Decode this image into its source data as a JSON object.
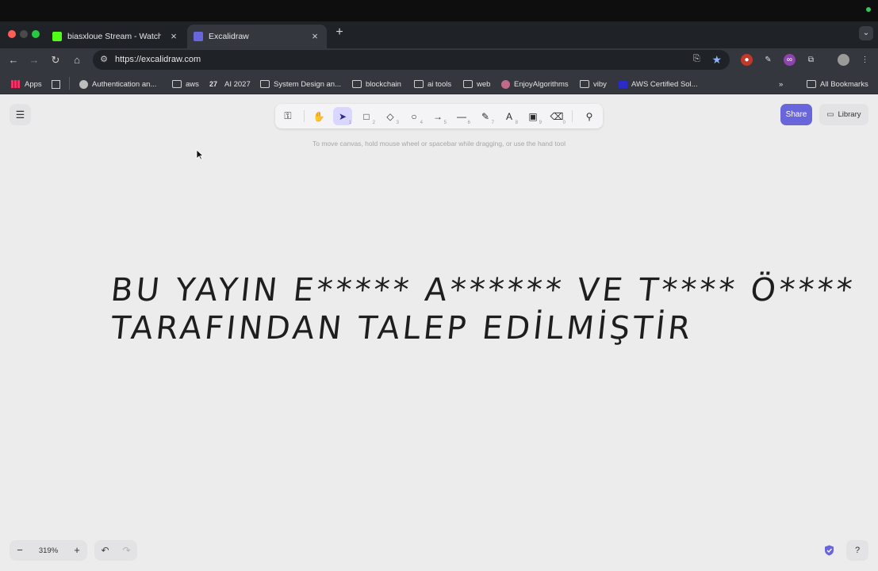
{
  "browser": {
    "tabs": [
      {
        "title": "biasxloue Stream - Watch Liv",
        "active": false,
        "favicon_color": "#53fc18"
      },
      {
        "title": "Excalidraw",
        "active": true,
        "favicon_color": "#6965db"
      }
    ],
    "close_glyph": "×",
    "new_tab_glyph": "+",
    "url": "https://excalidraw.com",
    "bookmarks": [
      {
        "label": "Apps",
        "icon": "apps-grid-icon"
      },
      {
        "label": "Authentication an...",
        "icon": "globe-icon"
      },
      {
        "label": "aws",
        "icon": "folder-icon"
      },
      {
        "label": "AI 2027",
        "icon": "ai2027-icon"
      },
      {
        "label": "System Design an...",
        "icon": "folder-icon"
      },
      {
        "label": "blockchain",
        "icon": "folder-icon"
      },
      {
        "label": "ai tools",
        "icon": "folder-icon"
      },
      {
        "label": "web",
        "icon": "folder-icon"
      },
      {
        "label": "EnjoyAlgorithms",
        "icon": "site-icon"
      },
      {
        "label": "viby",
        "icon": "folder-icon"
      },
      {
        "label": "AWS Certified Sol...",
        "icon": "site-icon"
      }
    ],
    "all_bookmarks": "All Bookmarks",
    "favicon_letter": "27"
  },
  "excalidraw": {
    "hint": "To move canvas, hold mouse wheel or spacebar while dragging, or use the hand tool",
    "tools": [
      {
        "name": "lock",
        "glyph": "⚿",
        "num": ""
      },
      {
        "name": "hand",
        "glyph": "✋",
        "num": ""
      },
      {
        "name": "selection",
        "glyph": "➤",
        "num": "1",
        "selected": true
      },
      {
        "name": "rectangle",
        "glyph": "□",
        "num": "2"
      },
      {
        "name": "diamond",
        "glyph": "◇",
        "num": "3"
      },
      {
        "name": "ellipse",
        "glyph": "○",
        "num": "4"
      },
      {
        "name": "arrow",
        "glyph": "→",
        "num": "5"
      },
      {
        "name": "line",
        "glyph": "—",
        "num": "6"
      },
      {
        "name": "draw",
        "glyph": "✎",
        "num": "7"
      },
      {
        "name": "text",
        "glyph": "A",
        "num": "8"
      },
      {
        "name": "image",
        "glyph": "▣",
        "num": "9"
      },
      {
        "name": "eraser",
        "glyph": "⌫",
        "num": "0"
      },
      {
        "name": "extra-tools",
        "glyph": "⚲",
        "num": ""
      }
    ],
    "share_label": "Share",
    "library_label": "Library",
    "canvas_text": {
      "line1": "BU YAYIN E***** A****** VE T**** Ö****",
      "line2": "TARAFINDAN TALEP EDİLMİŞTİR"
    },
    "zoom": {
      "minus": "−",
      "value": "319%",
      "plus": "+"
    },
    "undo_glyph": "↶",
    "redo_glyph": "↷",
    "help_glyph": "?",
    "menu_glyph": "☰",
    "accent": "#6965db"
  }
}
